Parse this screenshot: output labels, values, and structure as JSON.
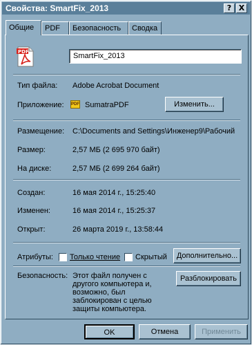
{
  "window": {
    "title": "Свойства: SmartFix_2013"
  },
  "titlebar_buttons": {
    "help": "?",
    "close": "X"
  },
  "tabs": [
    {
      "label": "Общие",
      "active": true
    },
    {
      "label": "PDF",
      "active": false
    },
    {
      "label": "Безопасность",
      "active": false
    },
    {
      "label": "Сводка",
      "active": false
    }
  ],
  "file": {
    "icon": "pdf-file-icon",
    "name": "SmartFix_2013",
    "type_label": "Тип файла:",
    "type_value": "Adobe Acrobat Document",
    "app_label": "Приложение:",
    "app_value": "SumatraPDF",
    "app_icon_text": "PDF",
    "change_button": "Изменить..."
  },
  "location": {
    "location_label": "Размещение:",
    "location_value": "C:\\Documents and Settings\\Инженер9\\Рабочий",
    "size_label": "Размер:",
    "size_value": "2,57 МБ (2 695 970 байт)",
    "disk_label": "На диске:",
    "disk_value": "2,57 МБ (2 699 264 байт)"
  },
  "dates": {
    "created_label": "Создан:",
    "created_value": "16 мая 2014 г., 15:25:40",
    "modified_label": "Изменен:",
    "modified_value": "16 мая 2014 г., 15:25:37",
    "opened_label": "Открыт:",
    "opened_value": "26 марта 2019 г., 13:58:44"
  },
  "attributes": {
    "label": "Атрибуты:",
    "readonly_label": "Только чтение",
    "readonly_checked": false,
    "hidden_label": "Скрытый",
    "hidden_checked": false,
    "advanced_button": "Дополнительно..."
  },
  "security": {
    "label": "Безопасность:",
    "text_lines": [
      "Этот файл получен с",
      "другого компьютера и,",
      "возможно, был",
      "заблокирован с целью",
      "защиты компьютера."
    ],
    "unblock_button": "Разблокировать"
  },
  "footer": {
    "ok": "OK",
    "cancel": "Отмена",
    "apply": "Применить",
    "apply_disabled": true
  },
  "colors": {
    "titlebar": "#5a7f9a",
    "window_bg": "#8fadc2",
    "desktop": "#6e96b0",
    "pdf_red": "#d8231c"
  }
}
